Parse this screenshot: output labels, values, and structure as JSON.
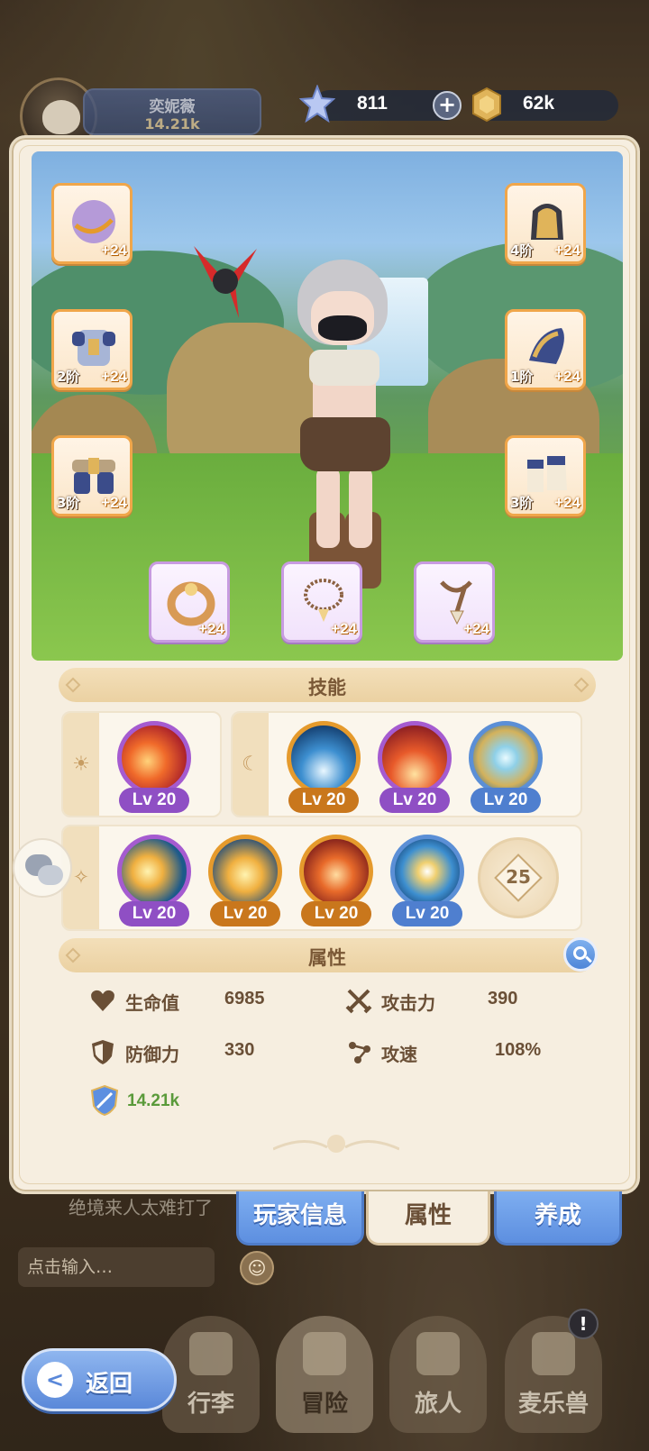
{
  "header": {
    "player_name": "奕妮薇",
    "player_power": "14.21k",
    "gems": "811",
    "gold": "62k",
    "icons": {
      "gem": "star-crystal-icon",
      "gold": "gold-coin-icon",
      "plus": "plus-icon"
    }
  },
  "equipment": {
    "left": [
      {
        "name": "orb",
        "tier": "",
        "level": "+24"
      },
      {
        "name": "armor",
        "tier": "2阶",
        "level": "+24"
      },
      {
        "name": "belt",
        "tier": "3阶",
        "level": "+24"
      }
    ],
    "right": [
      {
        "name": "helmet",
        "tier": "4阶",
        "level": "+24"
      },
      {
        "name": "gauntlet",
        "tier": "1阶",
        "level": "+24"
      },
      {
        "name": "boots",
        "tier": "3阶",
        "level": "+24"
      }
    ],
    "accessories": [
      {
        "name": "ring",
        "level": "+24"
      },
      {
        "name": "necklace",
        "level": "+24"
      },
      {
        "name": "amulet",
        "level": "+24"
      }
    ]
  },
  "skills": {
    "title": "技能",
    "group_sun": {
      "symbol": "☀",
      "items": [
        {
          "level": "Lv 20",
          "rarity": "purple"
        }
      ]
    },
    "group_moon": {
      "symbol": "☾",
      "items": [
        {
          "level": "Lv 20",
          "rarity": "gold"
        },
        {
          "level": "Lv 20",
          "rarity": "purple"
        },
        {
          "level": "Lv 20",
          "rarity": "blue"
        }
      ]
    },
    "group_star": {
      "symbol": "✧",
      "items": [
        {
          "level": "Lv 20",
          "rarity": "purple"
        },
        {
          "level": "Lv 20",
          "rarity": "gold"
        },
        {
          "level": "Lv 20",
          "rarity": "gold"
        },
        {
          "level": "Lv 20",
          "rarity": "blue"
        }
      ],
      "locked_level": "25"
    }
  },
  "attributes": {
    "title": "属性",
    "hp_label": "生命值",
    "hp_value": "6985",
    "atk_label": "攻击力",
    "atk_value": "390",
    "def_label": "防御力",
    "def_value": "330",
    "spd_label": "攻速",
    "spd_value": "108%",
    "power_value": "14.21k"
  },
  "tabs": {
    "player_info": "玩家信息",
    "attributes": "属性",
    "develop": "养成"
  },
  "chat": {
    "last_message": "绝境来人太难打了",
    "input_placeholder": "点击输入…"
  },
  "nav": {
    "back": "返回",
    "items": [
      "行李",
      "冒险",
      "旅人",
      "麦乐兽"
    ],
    "notice": "!"
  },
  "colors": {
    "panel": "#f6eee0",
    "accent_blue": "#5d8fe0",
    "power_green": "#5a9a3a",
    "text_brown": "#6a4f36"
  }
}
